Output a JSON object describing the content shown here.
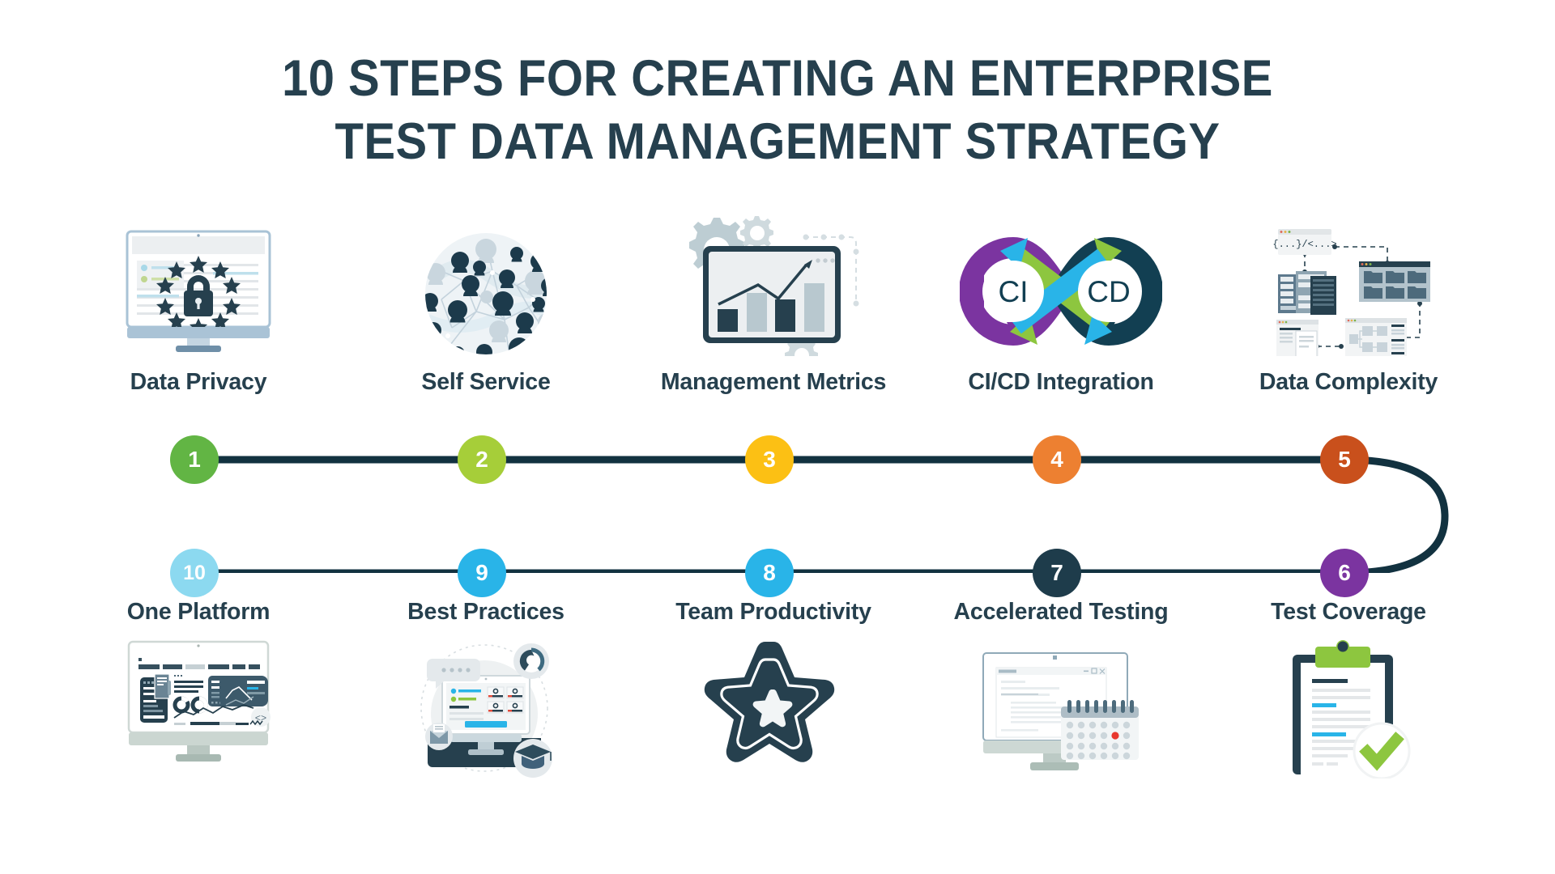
{
  "title": {
    "line1": "10 Steps for Creating an Enterprise",
    "line2": "Test Data Management Strategy",
    "color": "#26404e"
  },
  "theme": {
    "text_dark": "#26404e",
    "line_color": "#123240",
    "background": "#ffffff"
  },
  "timeline": {
    "top_row": [
      {
        "number": "1",
        "label": "Data Privacy",
        "color": "#62b544",
        "icon": "monitor-lock-stars-icon"
      },
      {
        "number": "2",
        "label": "Self Service",
        "color": "#a6ce39",
        "icon": "user-network-circle-icon"
      },
      {
        "number": "3",
        "label": "Management Metrics",
        "color": "#fcc014",
        "icon": "dashboard-bar-chart-gears-icon"
      },
      {
        "number": "4",
        "label": "CI/CD Integration",
        "color": "#ed8031",
        "icon": "cicd-infinity-loop-icon"
      },
      {
        "number": "5",
        "label": "Data Complexity",
        "color": "#c9501c",
        "icon": "connected-windows-servers-icon"
      }
    ],
    "bottom_row": [
      {
        "number": "10",
        "label": "One Platform",
        "color": "#8cd9f0",
        "icon": "monitor-analytics-dashboard-icon"
      },
      {
        "number": "9",
        "label": "Best Practices",
        "color": "#29b4e8",
        "icon": "monitor-learning-chat-icon"
      },
      {
        "number": "8",
        "label": "Team Productivity",
        "color": "#29b4e8",
        "icon": "nested-star-icon"
      },
      {
        "number": "7",
        "label": "Accelerated Testing",
        "color": "#1e3c4b",
        "icon": "monitor-calendar-icon"
      },
      {
        "number": "6",
        "label": "Test Coverage",
        "color": "#7b34a0",
        "icon": "clipboard-checkmark-icon"
      }
    ],
    "cicd_icon_text": {
      "left": "CI",
      "right": "CD"
    },
    "code_window_text": "{...}/<...>"
  }
}
